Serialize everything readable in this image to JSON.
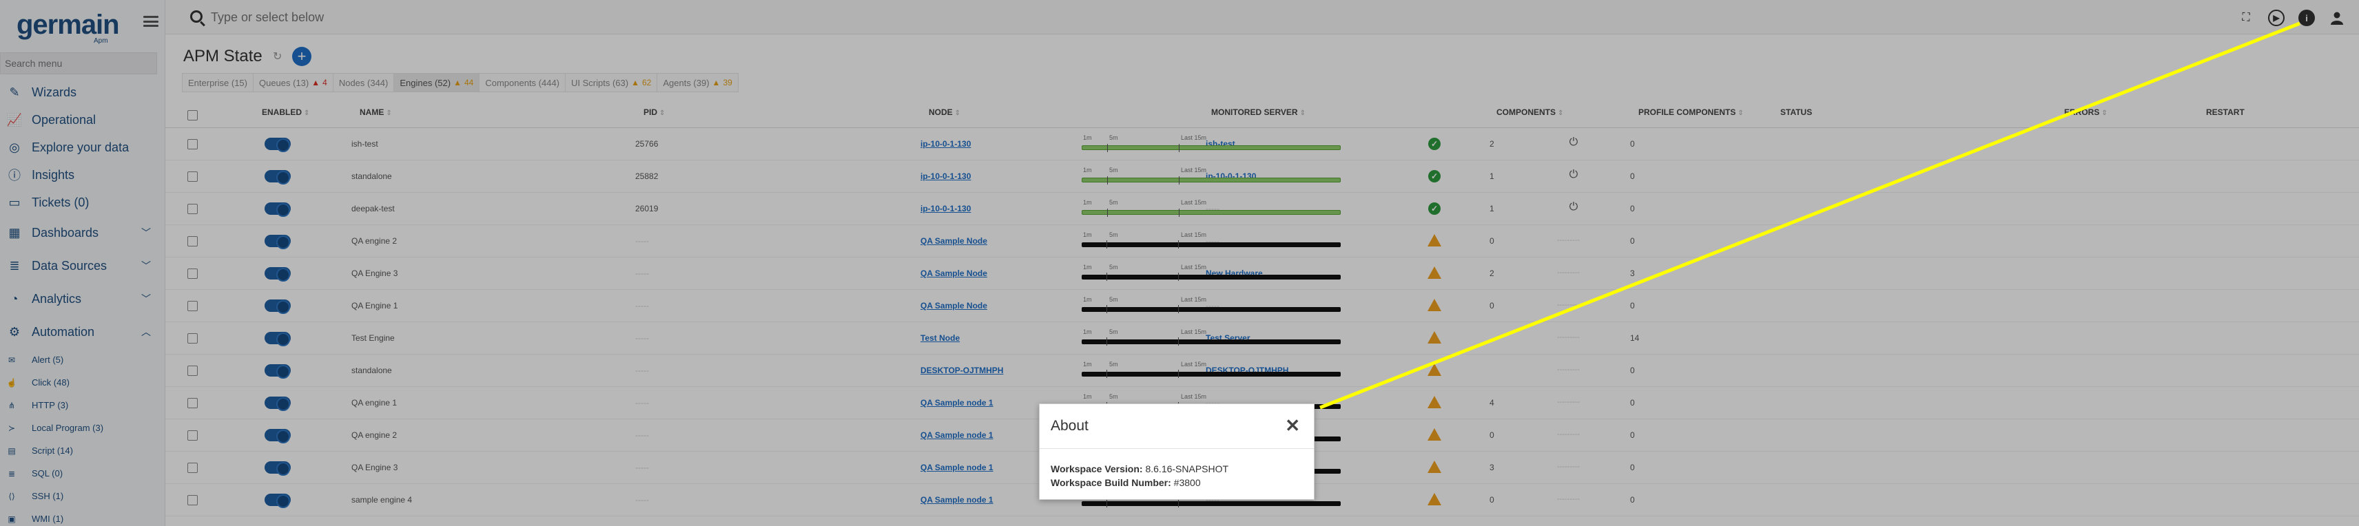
{
  "brand": {
    "name": "germain",
    "sub": "Apm"
  },
  "sidebar": {
    "search_placeholder": "Search menu",
    "items": [
      {
        "label": "Wizards",
        "icon": "magic-wand-icon"
      },
      {
        "label": "Operational",
        "icon": "chart-line-icon"
      },
      {
        "label": "Explore your data",
        "icon": "binoculars-icon"
      },
      {
        "label": "Insights",
        "icon": "info-icon"
      },
      {
        "label": "Tickets (0)",
        "icon": "ticket-icon"
      }
    ],
    "groups": [
      {
        "label": "Dashboards",
        "icon": "dashboard-icon",
        "expanded": false
      },
      {
        "label": "Data Sources",
        "icon": "database-icon",
        "expanded": false
      },
      {
        "label": "Analytics",
        "icon": "gauge-icon",
        "expanded": false
      },
      {
        "label": "Automation",
        "icon": "gears-icon",
        "expanded": true
      }
    ],
    "sub_items": [
      {
        "label": "Alert (5)",
        "icon": "envelope-icon"
      },
      {
        "label": "Click (48)",
        "icon": "pointer-icon"
      },
      {
        "label": "HTTP (3)",
        "icon": "network-icon"
      },
      {
        "label": "Local Program (3)",
        "icon": "terminal-icon"
      },
      {
        "label": "Script (14)",
        "icon": "file-icon"
      },
      {
        "label": "SQL (0)",
        "icon": "database-icon"
      },
      {
        "label": "SSH (1)",
        "icon": "code-icon"
      },
      {
        "label": "WMI (1)",
        "icon": "window-icon"
      }
    ]
  },
  "topbar": {
    "search_placeholder": "Type or select below"
  },
  "page": {
    "title": "APM State"
  },
  "tabs": [
    {
      "label": "Enterprise (15)",
      "badge": "",
      "badge_type": ""
    },
    {
      "label": "Queues (13)",
      "badge": "4",
      "badge_type": "error"
    },
    {
      "label": "Nodes (344)",
      "badge": "",
      "badge_type": ""
    },
    {
      "label": "Engines (52)",
      "badge": "44",
      "badge_type": "warning",
      "active": true
    },
    {
      "label": "Components (444)",
      "badge": "",
      "badge_type": ""
    },
    {
      "label": "UI Scripts (63)",
      "badge": "62",
      "badge_type": "warning"
    },
    {
      "label": "Agents (39)",
      "badge": "39",
      "badge_type": "warning"
    }
  ],
  "table": {
    "headers": {
      "enabled": "ENABLED",
      "name": "NAME",
      "pid": "PID",
      "node": "NODE",
      "monitored_server": "MONITORED SERVER",
      "components": "COMPONENTS",
      "profile_components": "PROFILE COMPONENTS",
      "status": "STATUS",
      "errors": "ERRORS",
      "restart": "RESTART"
    },
    "status_labels": {
      "a": "1m",
      "b": "5m",
      "c": "Last 15m"
    },
    "empty_text": "-----",
    "restart_empty_text": "---------",
    "rows": [
      {
        "name": "ish-test",
        "pid": "25766",
        "node": "ip-10-0-1-130",
        "server": "ish-test",
        "components": "2",
        "profile": "0",
        "ok": true
      },
      {
        "name": "standalone",
        "pid": "25882",
        "node": "ip-10-0-1-130",
        "server": "ip-10-0-1-130",
        "components": "1",
        "profile": "0",
        "ok": true
      },
      {
        "name": "deepak-test",
        "pid": "26019",
        "node": "ip-10-0-1-130",
        "server": "",
        "components": "1",
        "profile": "0",
        "ok": true
      },
      {
        "name": "QA engine 2",
        "pid": "",
        "node": "QA Sample Node",
        "server": "",
        "components": "0",
        "profile": "0",
        "ok": false
      },
      {
        "name": "QA Engine 3",
        "pid": "",
        "node": "QA Sample Node",
        "server": "New Hardware",
        "components": "2",
        "profile": "3",
        "ok": false
      },
      {
        "name": "QA Engine 1",
        "pid": "",
        "node": "QA Sample Node",
        "server": "",
        "components": "0",
        "profile": "0",
        "ok": false
      },
      {
        "name": "Test Engine",
        "pid": "",
        "node": "Test Node",
        "server": "Test Server",
        "components": "",
        "profile": "14",
        "ok": false
      },
      {
        "name": "standalone",
        "pid": "",
        "node": "DESKTOP-OJTMHPH",
        "server": "DESKTOP-OJTMHPH",
        "components": "",
        "profile": "0",
        "ok": false
      },
      {
        "name": "QA engine 1",
        "pid": "",
        "node": "QA Sample node 1",
        "server": "",
        "components": "4",
        "profile": "0",
        "ok": false
      },
      {
        "name": "QA engine 2",
        "pid": "",
        "node": "QA Sample node 1",
        "server": "",
        "components": "0",
        "profile": "0",
        "ok": false
      },
      {
        "name": "QA Engine 3",
        "pid": "",
        "node": "QA Sample node 1",
        "server": "",
        "components": "3",
        "profile": "0",
        "ok": false
      },
      {
        "name": "sample engine 4",
        "pid": "",
        "node": "QA Sample node 1",
        "server": "",
        "components": "0",
        "profile": "0",
        "ok": false
      }
    ]
  },
  "dialog": {
    "title": "About",
    "version_label": "Workspace Version:",
    "version_value": "8.6.16-SNAPSHOT",
    "build_label": "Workspace Build Number:",
    "build_value": "#3800"
  },
  "colors": {
    "brand": "#1f4f82",
    "accent": "#1f6fc8",
    "ok": "#2e9a3e",
    "warning": "#f0a020",
    "error": "#d93025",
    "annotation": "#ffff00"
  }
}
